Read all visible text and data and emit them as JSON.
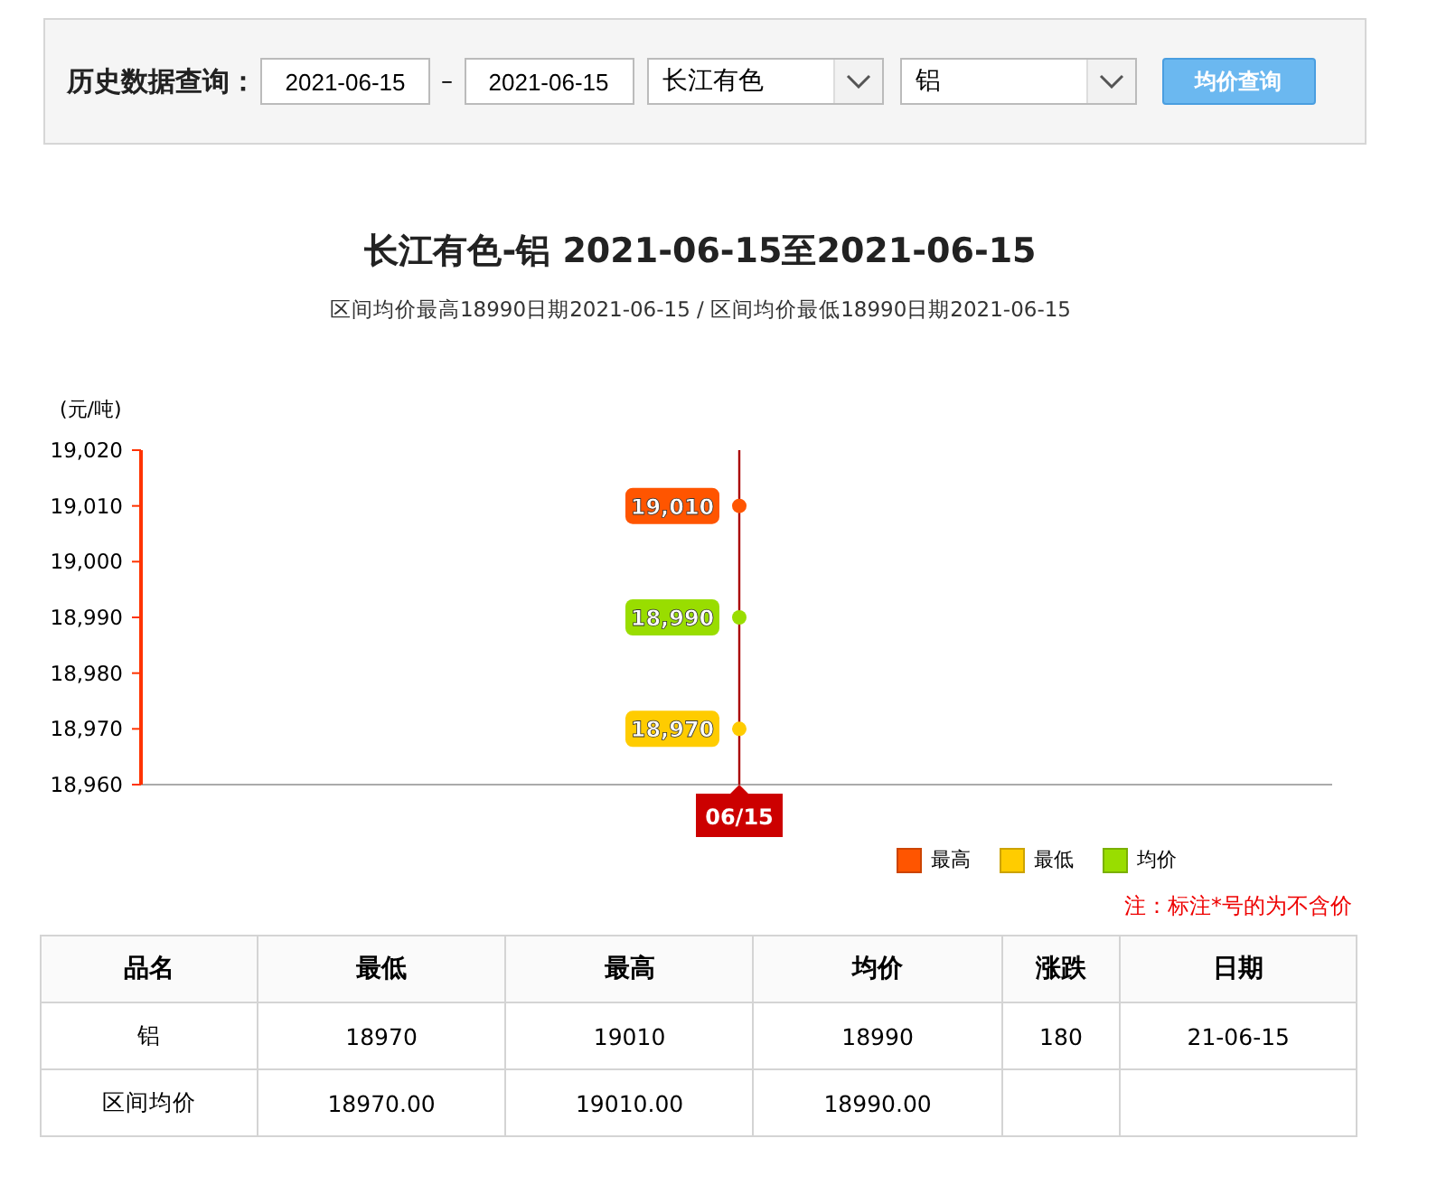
{
  "search": {
    "label": "历史数据查询：",
    "start_date": "2021-06-15",
    "separator": "–",
    "end_date": "2021-06-15",
    "market": "长江有色",
    "metal": "铝",
    "button": "均价查询"
  },
  "chart": {
    "title": "长江有色-铝 2021-06-15至2021-06-15",
    "subtitle": "区间均价最高18990日期2021-06-15 / 区间均价最低18990日期2021-06-15",
    "unit": "(元/吨)",
    "chart_data": {
      "type": "line",
      "categories": [
        "06/15"
      ],
      "ylim": [
        18960,
        19020
      ],
      "yticks": [
        {
          "value": 18960,
          "label": "18,960"
        },
        {
          "value": 18970,
          "label": "18,970"
        },
        {
          "value": 18980,
          "label": "18,980"
        },
        {
          "value": 18990,
          "label": "18,990"
        },
        {
          "value": 19000,
          "label": "19,000"
        },
        {
          "value": 19010,
          "label": "19,010"
        },
        {
          "value": 19020,
          "label": "19,020"
        }
      ],
      "data_labels": true,
      "ref_lines": [
        {
          "axis": "x",
          "value": "06/15",
          "color": "#aa0000"
        }
      ],
      "series": [
        {
          "name": "最高",
          "color": "#ff5500",
          "marker": "circle",
          "values": [
            19010
          ],
          "value_labels": [
            "19,010"
          ]
        },
        {
          "name": "最低",
          "color": "#ffcc00",
          "marker": "circle",
          "values": [
            18970
          ],
          "value_labels": [
            "18,970"
          ]
        },
        {
          "name": "均价",
          "color": "#99dd00",
          "marker": "circle",
          "values": [
            18990
          ],
          "value_labels": [
            "18,990"
          ]
        }
      ]
    }
  },
  "note": "注：标注*号的为不含价",
  "table": {
    "columns": [
      "品名",
      "最低",
      "最高",
      "均价",
      "涨跌",
      "日期"
    ],
    "rows": [
      [
        "铝",
        "18970",
        "19010",
        "18990",
        "180",
        "21-06-15"
      ],
      [
        "区间均价",
        "18970.00",
        "19010.00",
        "18990.00",
        "",
        ""
      ]
    ]
  }
}
